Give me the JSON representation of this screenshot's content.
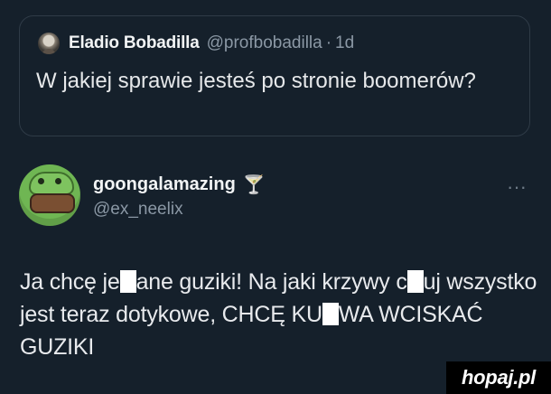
{
  "quoted_tweet": {
    "author_name": "Eladio Bobadilla",
    "author_handle": "@profbobadilla",
    "separator": "·",
    "time": "1d",
    "text": "W jakiej sprawie jesteś po stronie boomerów?"
  },
  "tweet": {
    "author_name": "goongalamazing",
    "author_handle": "@ex_neelix",
    "author_emoji": "🍸",
    "more_icon": "···",
    "text_parts": {
      "p1": "Ja chcę je",
      "p2": "ane guziki! Na jaki krzywy c",
      "p3": "uj wszystko jest teraz dotykowe, CHCĘ KU",
      "p4": "WA WCISKAĆ GUZIKI"
    }
  },
  "watermark": {
    "label": "hopaj.pl"
  }
}
